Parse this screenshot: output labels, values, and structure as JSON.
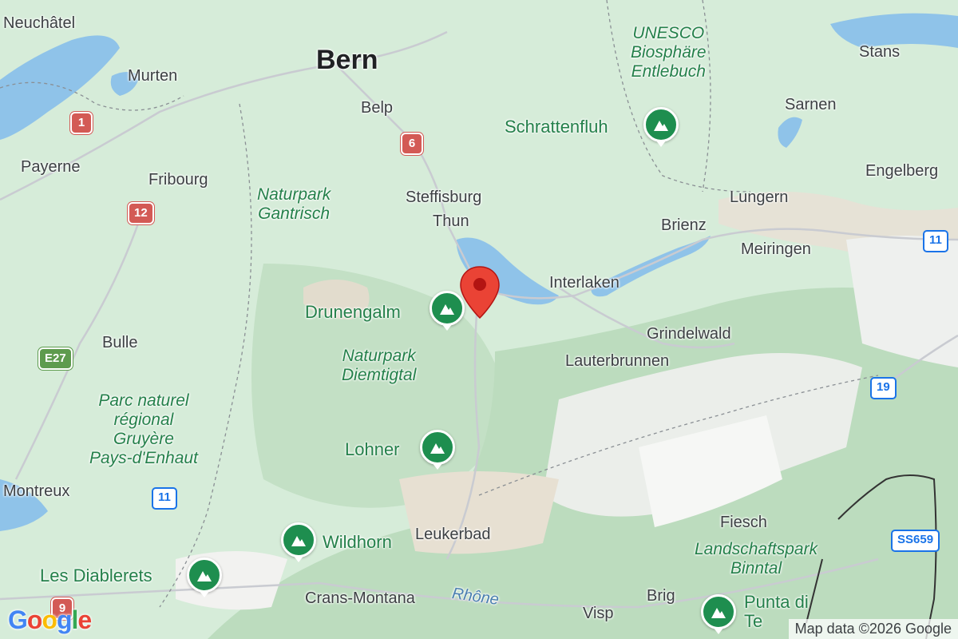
{
  "map": {
    "marker_color": "#ea4335",
    "park_color": "#24804a",
    "lake_color": "#8fc3e9",
    "places": {
      "neuchatel": "Neuchâtel",
      "bern": "Bern",
      "murten": "Murten",
      "belp": "Belp",
      "payerne": "Payerne",
      "fribourg": "Fribourg",
      "steffisburg": "Steffisburg",
      "thun": "Thun",
      "interlaken": "Interlaken",
      "brienz": "Brienz",
      "meiringen": "Meiringen",
      "lungern": "Lungern",
      "sarnen": "Sarnen",
      "stans": "Stans",
      "engelberg": "Engelberg",
      "grindelwald": "Grindelwald",
      "lauterbrunnen": "Lauterbrunnen",
      "bulle": "Bulle",
      "montreux": "Montreux",
      "leukerbad": "Leukerbad",
      "crans_montana": "Crans-Montana",
      "brig": "Brig",
      "visp": "Visp",
      "fiesch": "Fiesch"
    },
    "parks": {
      "unesco": "UNESCO\nBiosphäre\nEntlebuch",
      "gantrisch": "Naturpark\nGantrisch",
      "diemtigtal": "Naturpark\nDiemtigtal",
      "gruyere": "Parc naturel\nrégional\nGruyère\nPays-d'Enhaut",
      "binntal": "Landschaftspark\nBinntal"
    },
    "peaks": {
      "schrattenfluh": "Schrattenfluh",
      "drunengalm": "Drunengalm",
      "lohner": "Lohner",
      "wildhorn": "Wildhorn",
      "les_diablerets": "Les Diablerets",
      "punta_di_te": "Punta di\nTe"
    },
    "river": "Rhône",
    "shields": {
      "r1": "1",
      "r6": "6",
      "r12": "12",
      "e27": "E27",
      "a11_west": "11",
      "a11_east": "11",
      "r19": "19",
      "ss659": "SS659",
      "r9": "9"
    }
  },
  "branding": {
    "logo": "Google",
    "attribution": "Map data ©2026 Google"
  }
}
